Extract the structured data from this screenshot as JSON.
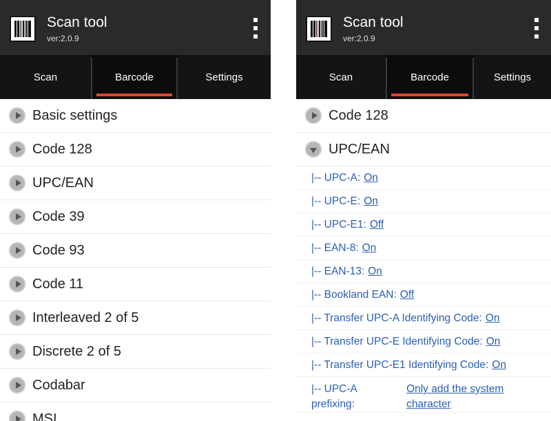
{
  "left": {
    "app": {
      "title": "Scan tool",
      "version": "ver:2.0.9"
    },
    "tabs": [
      {
        "label": "Scan",
        "active": false
      },
      {
        "label": "Barcode",
        "active": true
      },
      {
        "label": "Settings",
        "active": false
      }
    ],
    "categories": [
      "Basic settings",
      "Code 128",
      "UPC/EAN",
      "Code 39",
      "Code 93",
      "Code 11",
      "Interleaved 2 of 5",
      "Discrete 2 of 5",
      "Codabar",
      "MSI"
    ]
  },
  "right": {
    "app": {
      "title": "Scan tool",
      "version": "ver:2.0.9"
    },
    "tabs": [
      {
        "label": "Scan",
        "active": false
      },
      {
        "label": "Barcode",
        "active": true
      },
      {
        "label": "Settings",
        "active": false
      }
    ],
    "categories": [
      {
        "label": "Code 128",
        "expanded": false
      },
      {
        "label": "UPC/EAN",
        "expanded": true
      }
    ],
    "options": [
      {
        "label": "|-- UPC-A:",
        "value": "On"
      },
      {
        "label": "|-- UPC-E:",
        "value": "On"
      },
      {
        "label": "|-- UPC-E1:",
        "value": "Off"
      },
      {
        "label": "|-- EAN-8:",
        "value": "On"
      },
      {
        "label": "|-- EAN-13:",
        "value": "On"
      },
      {
        "label": "|-- Bookland EAN:",
        "value": "Off"
      },
      {
        "label": "|-- Transfer UPC-A Identifying Code:",
        "value": "On"
      },
      {
        "label": "|-- Transfer UPC-E Identifying Code:",
        "value": "On"
      },
      {
        "label": "|-- Transfer UPC-E1 Identifying Code:",
        "value": "On"
      },
      {
        "label": "|-- UPC-A prefixing:",
        "value": "Only add the system character"
      }
    ]
  },
  "colors": {
    "appbar": "#2a2a2a",
    "tabbar": "#141414",
    "tab_indicator": "#e8452c",
    "option_text": "#2a5fb3"
  }
}
